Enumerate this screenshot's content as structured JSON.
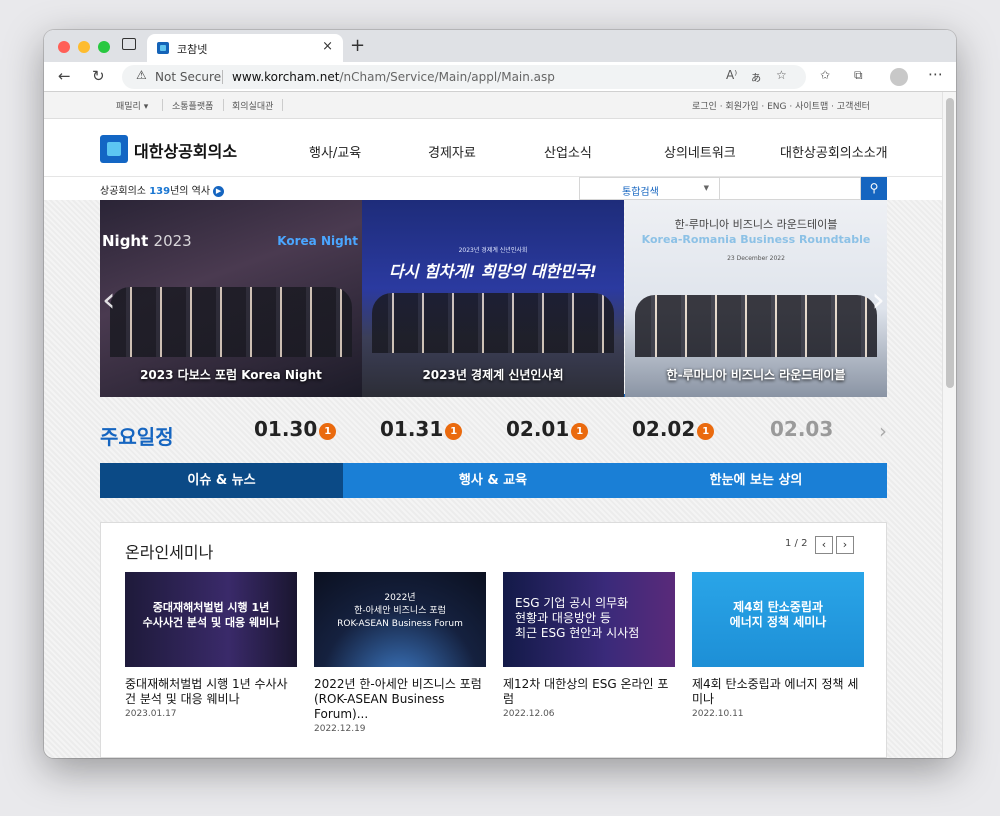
{
  "browser": {
    "tab_title": "코참넷",
    "tab_close": "×",
    "new_tab": "+",
    "url_warning": "Not Secure",
    "url_host": "www.korcham.net",
    "url_path": "/nCham/Service/Main/appl/Main.asp"
  },
  "util_bar": {
    "left": [
      "패밀리 ▾",
      "소통플랫폼",
      "회의실대관"
    ],
    "right": "로그인 · 회원가입 · ENG · 사이트맵 · 고객센터"
  },
  "header": {
    "logo_text": "대한상공회의소",
    "nav": [
      "행사/교육",
      "경제자료",
      "산업소식",
      "상의네트워크",
      "대한상공회의소소개"
    ]
  },
  "subbar": {
    "history_prefix": "상공회의소 ",
    "history_num": "139",
    "history_suffix": "년의 역사",
    "search_select": "통합검색",
    "search_value": ""
  },
  "slides": [
    {
      "caption": "2023 다보스 포럼 Korea Night",
      "line1": "Night",
      "line1b": "2023",
      "line2": "Korea Night"
    },
    {
      "caption": "2023년 경제계 신년인사회",
      "line1": "2023년 경제계 신년인사회",
      "line2": "다시 힘차게! 희망의 대한민국!"
    },
    {
      "caption": "한-루마니아 비즈니스 라운드테이블",
      "line1": "한-루마니아 비즈니스 라운드테이블",
      "line2": "Korea-Romania Business Roundtable",
      "line3": "23 December 2022"
    }
  ],
  "schedule": {
    "title": "주요일정",
    "dates": [
      {
        "date": "01.30",
        "count": "1"
      },
      {
        "date": "01.31",
        "count": "1"
      },
      {
        "date": "02.01",
        "count": "1"
      },
      {
        "date": "02.02",
        "count": "1"
      },
      {
        "date": "02.03",
        "count": ""
      }
    ]
  },
  "content_tabs": [
    "이슈 & 뉴스",
    "행사 & 교육",
    "한눈에 보는 상의"
  ],
  "webinar": {
    "title": "온라인세미나",
    "pager": "1 / 2",
    "cards": [
      {
        "thumb": "중대재해처벌법 시행 1년\n수사사건 분석 및 대응 웨비나",
        "title": "중대재해처벌법 시행 1년 수사사건 분석 및 대응 웨비나",
        "date": "2023.01.17"
      },
      {
        "thumb": "2022년\n한-아세안 비즈니스 포럼\nROK-ASEAN Business Forum",
        "title": "2022년 한-아세안 비즈니스 포럼 (ROK-ASEAN Business Forum)...",
        "date": "2022.12.19"
      },
      {
        "thumb": "ESG 기업 공시 의무화\n현황과 대응방안 등\n최근 ESG 현안과 시사점",
        "title": "제12차 대한상의 ESG 온라인 포럼",
        "date": "2022.12.06"
      },
      {
        "thumb": "제4회 탄소중립과\n에너지 정책 세미나",
        "title": "제4회 탄소중립과 에너지 정책 세미나",
        "date": "2022.10.11"
      }
    ]
  },
  "colors": {
    "brand_blue": "#1565c0",
    "tab_blue": "#1a7fd6",
    "tab_active": "#0b4a86",
    "badge_orange": "#ea6a0e"
  }
}
